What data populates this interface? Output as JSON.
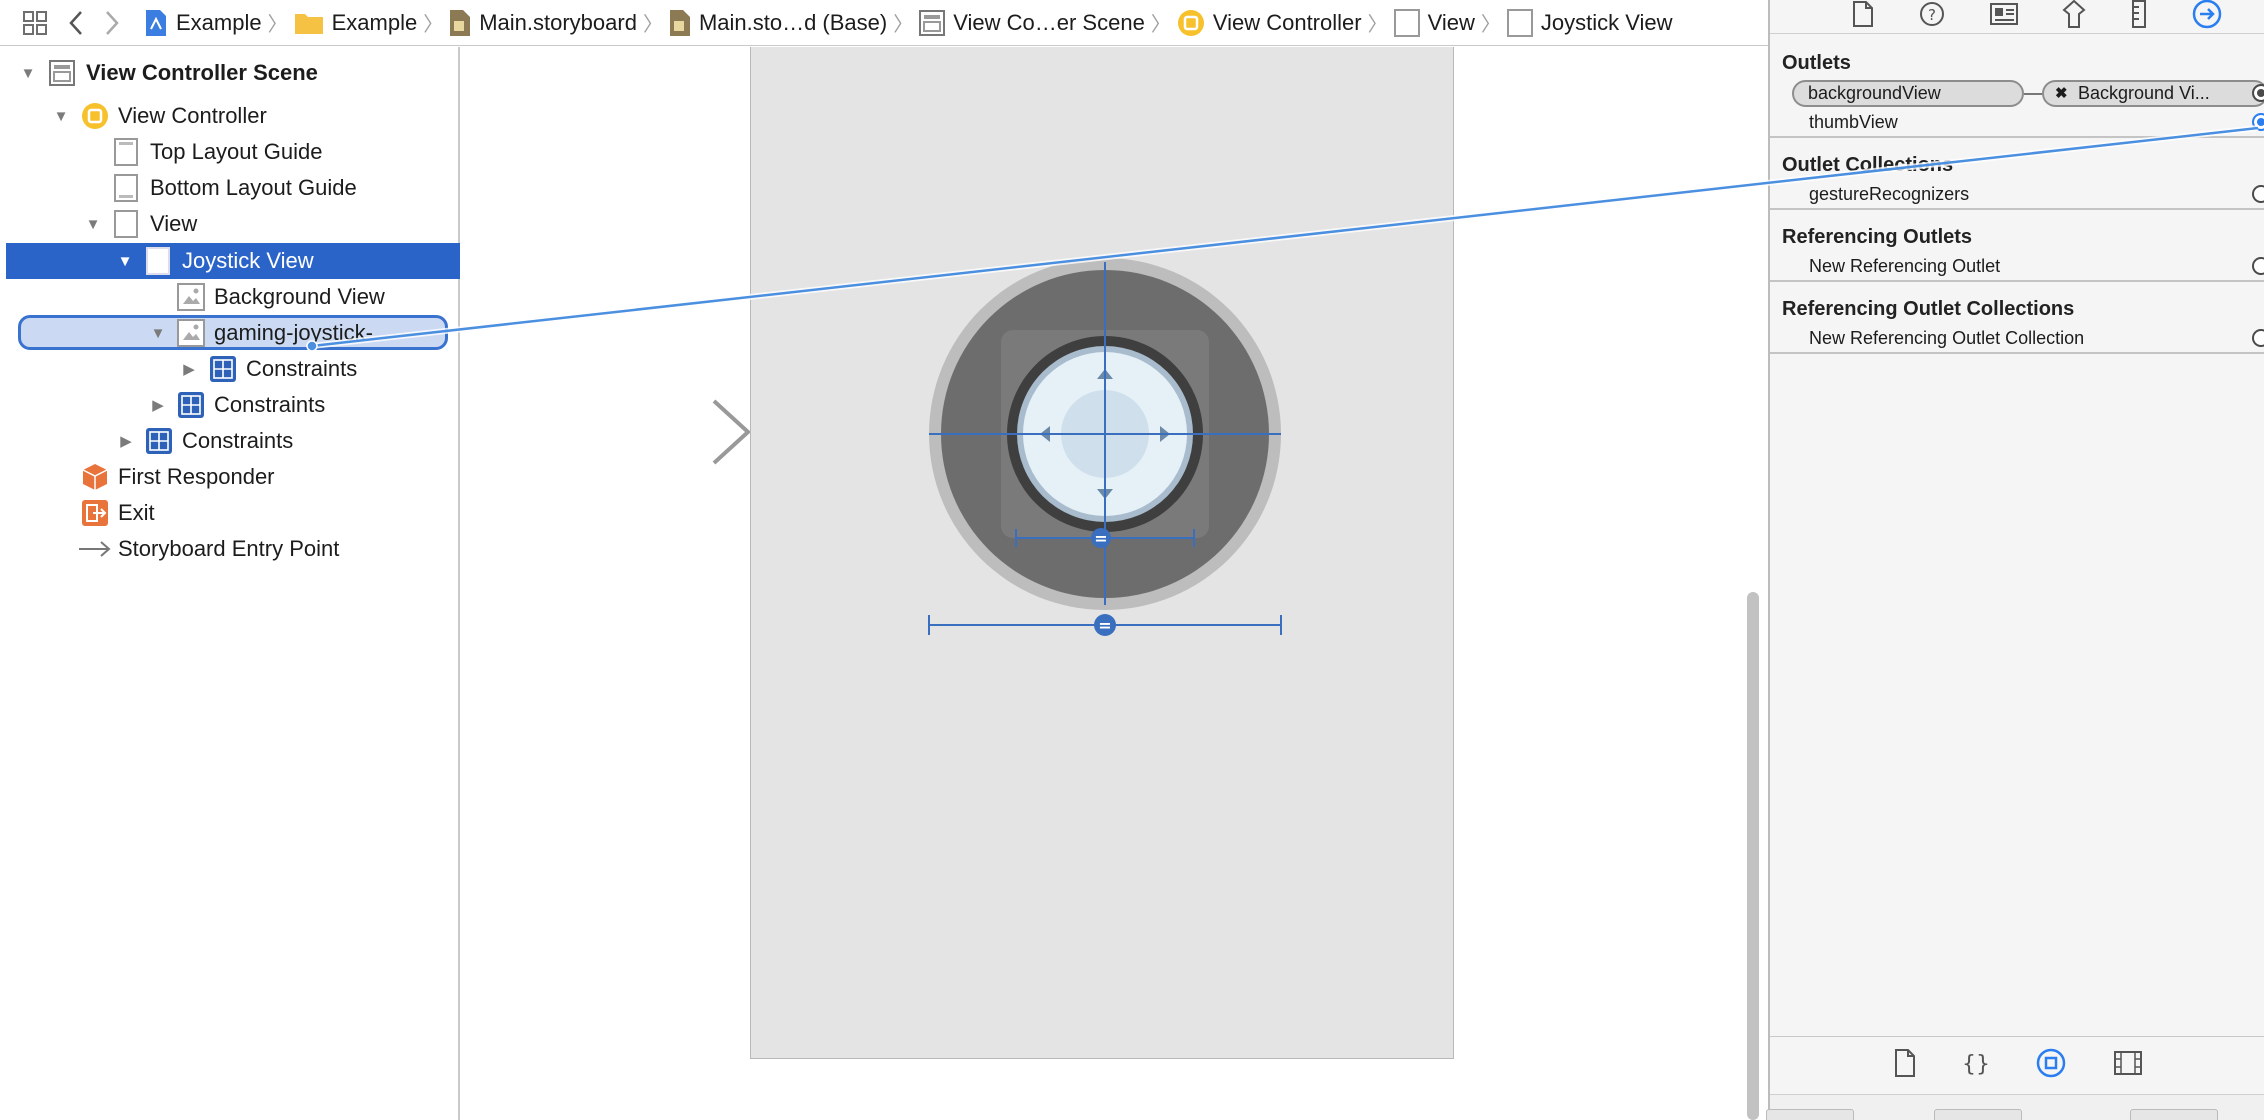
{
  "breadcrumb": [
    {
      "label": "Example",
      "icon": "xcode-project-icon"
    },
    {
      "label": "Example",
      "icon": "folder-icon"
    },
    {
      "label": "Main.storyboard",
      "icon": "storyboard-file-icon"
    },
    {
      "label": "Main.sto…d (Base)",
      "icon": "storyboard-file-icon"
    },
    {
      "label": "View Co…er Scene",
      "icon": "scene-icon"
    },
    {
      "label": "View Controller",
      "icon": "view-controller-icon"
    },
    {
      "label": "View",
      "icon": "view-icon"
    },
    {
      "label": "Joystick View",
      "icon": "view-icon"
    }
  ],
  "outline": {
    "scene": "View Controller Scene",
    "view_controller": "View Controller",
    "top_layout_guide": "Top Layout Guide",
    "bottom_layout_guide": "Bottom Layout Guide",
    "view": "View",
    "joystick_view": "Joystick View",
    "background_view": "Background View",
    "editing_item": "gaming-joystick-",
    "constraints": "Constraints",
    "first_responder": "First Responder",
    "exit": "Exit",
    "entry_point": "Storyboard Entry Point"
  },
  "inspector": {
    "outlets_header": "Outlets",
    "outlet_background": "backgroundView",
    "outlet_background_target": "Background Vi...",
    "outlet_thumb": "thumbView",
    "outlet_collections_header": "Outlet Collections",
    "gesture_recognizers": "gestureRecognizers",
    "referencing_outlets_header": "Referencing Outlets",
    "new_referencing_outlet": "New Referencing Outlet",
    "referencing_collections_header": "Referencing Outlet Collections",
    "new_referencing_collection": "New Referencing Outlet Collection"
  },
  "colors": {
    "selection": "#2b64c9",
    "connection_line": "#4b8fe0",
    "constraint": "#3a6fbf"
  }
}
